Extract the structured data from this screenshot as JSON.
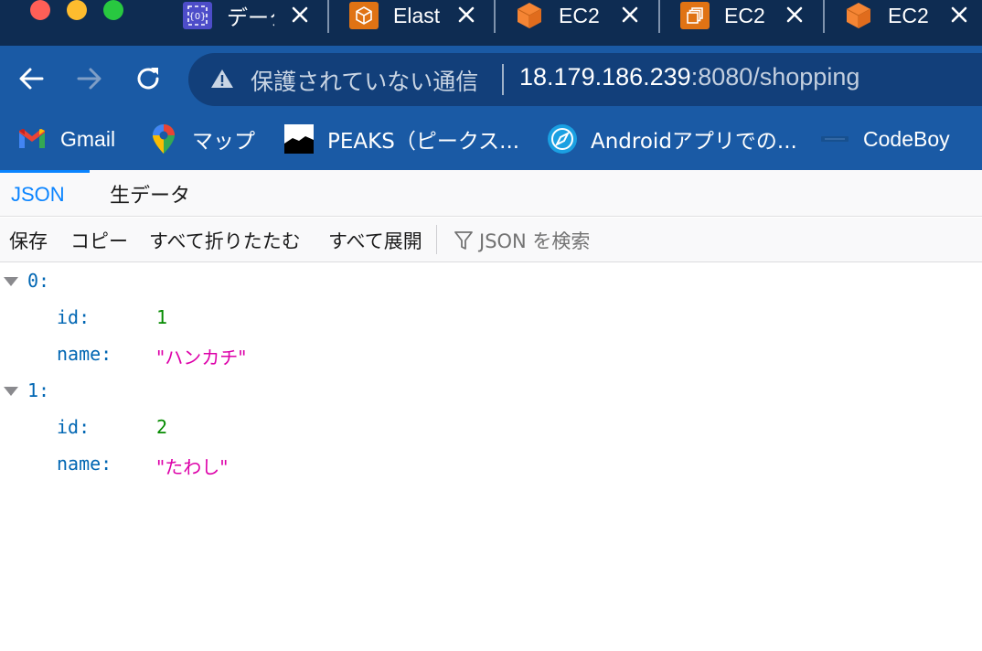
{
  "window": {
    "tabs": [
      {
        "title": "データ",
        "icon": "aws-data-service-icon",
        "color": "#4d4dc9"
      },
      {
        "title": "Elast",
        "icon": "elastic-beanstalk-icon",
        "color": "#e07314"
      },
      {
        "title": "EC2",
        "icon": "ec2-cube-icon",
        "color": "#f58534"
      },
      {
        "title": "EC2",
        "icon": "ec2-instances-icon",
        "color": "#e07314"
      },
      {
        "title": "EC2",
        "icon": "ec2-cube-icon",
        "color": "#f58534"
      }
    ]
  },
  "toolbar": {
    "security_text": "保護されていない通信",
    "url_host": "18.179.186.239",
    "url_rest": ":8080/shopping"
  },
  "bookmarks": [
    {
      "label": "Gmail",
      "icon": "gmail-icon"
    },
    {
      "label": "マップ",
      "icon": "maps-pin-icon"
    },
    {
      "label": "PEAKS（ピークス...",
      "icon": "peaks-icon"
    },
    {
      "label": "Androidアプリでの...",
      "icon": "compass-icon"
    },
    {
      "label": "CodeBoy",
      "icon": "codeboy-icon"
    }
  ],
  "viewer": {
    "tabs": {
      "json": "JSON",
      "raw": "生データ"
    },
    "actions": {
      "save": "保存",
      "copy": "コピー",
      "collapse_all": "すべて折りたたむ",
      "expand_all": "すべて展開",
      "filter_placeholder": "JSON を検索"
    }
  },
  "json_tree": [
    {
      "index": "0:",
      "id_key": "id:",
      "id_value": "1",
      "name_key": "name:",
      "name_value": "\"ハンカチ\""
    },
    {
      "index": "1:",
      "id_key": "id:",
      "id_value": "2",
      "name_key": "name:",
      "name_value": "\"たわし\""
    }
  ]
}
